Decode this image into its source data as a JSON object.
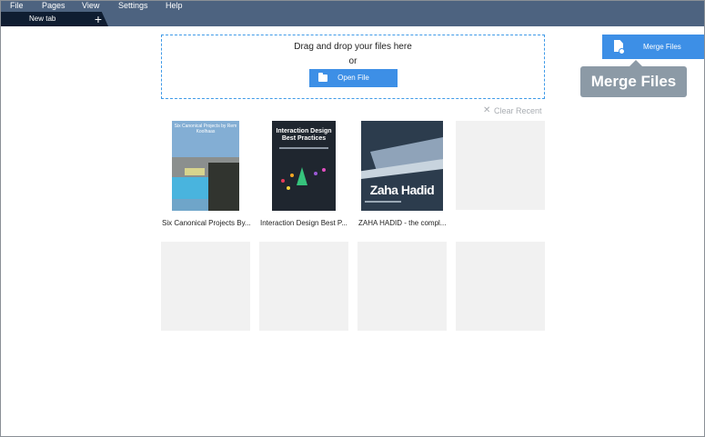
{
  "menu": {
    "items": [
      "File",
      "Pages",
      "View",
      "Settings",
      "Help"
    ]
  },
  "tabs": {
    "active_label": "New tab",
    "add_label": "+"
  },
  "dropzone": {
    "prompt": "Drag and drop your files here",
    "or_text": "or",
    "open_button_label": "Open File",
    "open_button_icon": "folder-icon"
  },
  "merge": {
    "button_label": "Merge Files",
    "button_icon": "merge-document-icon",
    "tooltip_text": "Merge Files"
  },
  "recent": {
    "clear_label": "Clear Recent",
    "clear_icon": "close-icon",
    "items": [
      {
        "caption": "Six Canonical Projects By...",
        "cover_title": "Six Canonical Projects by Rem Koolhaas"
      },
      {
        "caption": "Interaction Design Best P...",
        "cover_title": "Interaction Design Best Practices"
      },
      {
        "caption": "ZAHA HADID - the compl...",
        "cover_title": "Zaha Hadid"
      }
    ],
    "empty_slots": 5
  },
  "colors": {
    "topbar": "#4d6380",
    "tab_active": "#0f1d31",
    "accent": "#3d8fe6",
    "tooltip": "#8c9aa6",
    "placeholder": "#f1f1f1"
  }
}
